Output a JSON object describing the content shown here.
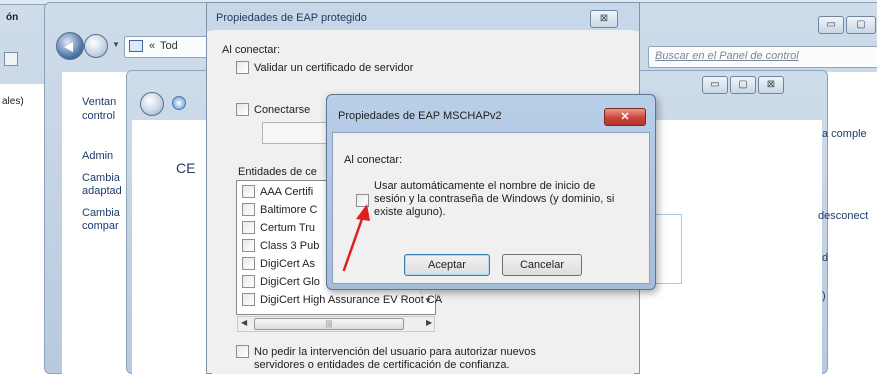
{
  "background": {
    "left_edge": [
      "ón",
      "ales)"
    ],
    "address": {
      "chevrons": "«",
      "crumb_partial": "Tod",
      "search_placeholder": "Buscar en el Panel de control"
    },
    "left_panel": [
      "Ventan",
      "control",
      "Admin",
      "Cambia",
      "adaptad",
      "Cambia",
      "compar"
    ],
    "content_partial": "CE",
    "right_partial": [
      "a comple",
      "desconect",
      "d",
      ")"
    ]
  },
  "eap_dialog": {
    "title": "Propiedades de EAP protegido",
    "when_connecting": "Al conectar:",
    "validate_cert": "Validar un certificado de servidor",
    "connect_to_partial": "Conectarse",
    "root_ca_label_partial": "Entidades de ce",
    "cert_list": [
      "AAA Certifi",
      "Baltimore C",
      "Certum Tru",
      "Class 3 Pub",
      "DigiCert As",
      "DigiCert Glo",
      "DigiCert High Assurance EV Root CA"
    ],
    "no_prompt_line1": "No pedir la intervención del usuario para autorizar nuevos",
    "no_prompt_line2": "servidores o entidades de certificación de confianza.",
    "close_glyph": "⊠"
  },
  "mschap_dialog": {
    "title": "Propiedades de EAP MSCHAPv2",
    "when_connecting": "Al conectar:",
    "auto_use_line1": "Usar automáticamente el nombre de inicio de",
    "auto_use_line2": "sesión y la contraseña de Windows (y dominio, si",
    "auto_use_line3": "existe alguno).",
    "ok_label": "Aceptar",
    "cancel_label": "Cancelar",
    "close_glyph": "✕"
  },
  "colors": {
    "annotation_arrow": "#e02020",
    "close_red": "#c9443a"
  }
}
